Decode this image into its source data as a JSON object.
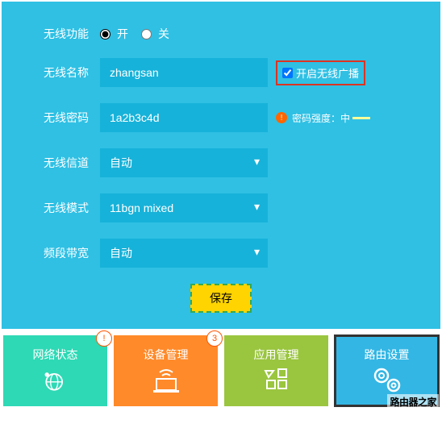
{
  "labels": {
    "func": "无线功能",
    "name": "无线名称",
    "pwd": "无线密码",
    "chan": "无线信道",
    "mode": "无线模式",
    "bw": "频段带宽"
  },
  "radio": {
    "on": "开",
    "off": "关",
    "checked": "on"
  },
  "name": {
    "value": "zhangsan",
    "bcast_label": "开启无线广播",
    "bcast": true
  },
  "pwd": {
    "value": "1a2b3c4d",
    "strength_label": "密码强度：",
    "strength": "中"
  },
  "chan": "自动",
  "mode": "11bgn mixed",
  "bw": "自动",
  "save": "保存",
  "tiles": {
    "t1": "网络状态",
    "t2": "设备管理",
    "t3": "应用管理",
    "t4": "路由设置",
    "b1": "!",
    "b2": "3"
  },
  "watermark": "路由器之家"
}
